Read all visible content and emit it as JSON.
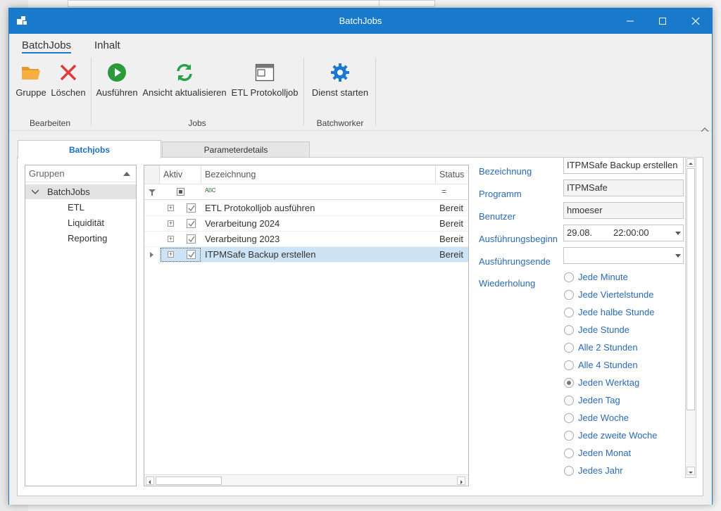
{
  "window": {
    "title": "BatchJobs"
  },
  "ribbon": {
    "tabs": [
      {
        "label": "BatchJobs",
        "active": true
      },
      {
        "label": "Inhalt",
        "active": false
      }
    ],
    "buttons": {
      "gruppe": "Gruppe",
      "loeschen": "Löschen",
      "ausfuehren": "Ausführen",
      "aktualisieren": "Ansicht aktualisieren",
      "etl": "ETL Protokolljob",
      "dienst": "Dienst starten"
    },
    "groups": {
      "bearbeiten": "Bearbeiten",
      "jobs": "Jobs",
      "batchworker": "Batchworker"
    }
  },
  "pageTabs": [
    {
      "label": "Batchjobs",
      "active": true
    },
    {
      "label": "Parameterdetails",
      "active": false
    }
  ],
  "groups_panel": {
    "header": "Gruppen",
    "root": "BatchJobs",
    "children": [
      "ETL",
      "Liquidität",
      "Reporting"
    ]
  },
  "grid": {
    "columns": {
      "aktiv": "Aktiv",
      "bezeichnung": "Bezeichnung",
      "status": "Status"
    },
    "rows": [
      {
        "aktiv": true,
        "name": "ETL Protokolljob ausführen",
        "status": "Bereit"
      },
      {
        "aktiv": true,
        "name": "Verarbeitung 2024",
        "status": "Bereit"
      },
      {
        "aktiv": true,
        "name": "Verarbeitung 2023",
        "status": "Bereit"
      },
      {
        "aktiv": true,
        "name": "ITPMSafe Backup erstellen",
        "status": "Bereit",
        "selected": true
      }
    ]
  },
  "details": {
    "bezeichnung": {
      "label": "Bezeichnung",
      "value": "ITPMSafe Backup erstellen"
    },
    "programm": {
      "label": "Programm",
      "value": "ITPMSafe"
    },
    "benutzer": {
      "label": "Benutzer",
      "value": "hmoeser"
    },
    "beginn": {
      "label": "Ausführungsbeginn",
      "date": "29.08.",
      "time": "22:00:00"
    },
    "ende": {
      "label": "Ausführungsende",
      "value": ""
    },
    "wiederholung": {
      "label": "Wiederholung",
      "options": [
        "Jede Minute",
        "Jede Viertelstunde",
        "Jede halbe Stunde",
        "Jede Stunde",
        "Alle 2 Stunden",
        "Alle 4 Stunden",
        "Jeden Werktag",
        "Jeden Tag",
        "Jede Woche",
        "Jede zweite Woche",
        "Jeden Monat",
        "Jedes Jahr"
      ],
      "selected": "Jeden Werktag"
    }
  },
  "colors": {
    "titlebar": "#1979ca",
    "accent": "#2b6bb5",
    "selection": "#cde3f6",
    "play": "#2a9a3a",
    "refresh": "#27a24a",
    "delete": "#e03a3a",
    "folder": "#f0a030",
    "gear": "#1a78d0"
  }
}
